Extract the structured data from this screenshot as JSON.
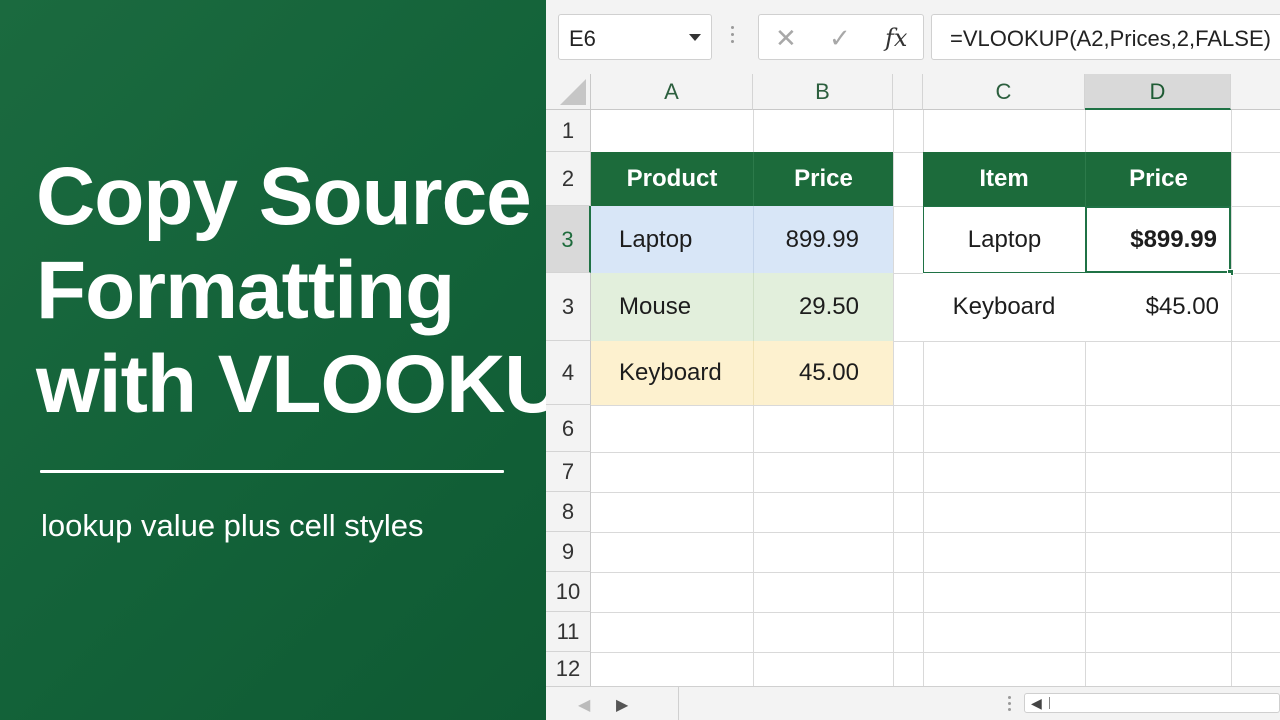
{
  "hero": {
    "title_lines": [
      "Copy Source",
      "Formatting",
      "with VLOOKUP"
    ],
    "subtitle": "lookup value plus cell styles"
  },
  "toolbar": {
    "name_box": "E6",
    "cancel_icon": "✕",
    "enter_icon": "✓",
    "fx_label": "fx",
    "formula": "=VLOOKUP(A2,Prices,2,FALSE)"
  },
  "columns": [
    "A",
    "B",
    "C",
    "D"
  ],
  "rows": [
    "1",
    "2",
    "3",
    "3",
    "4",
    "6",
    "7",
    "8",
    "9",
    "10",
    "11",
    "12"
  ],
  "source_table": {
    "headers": [
      "Product",
      "Price"
    ],
    "rows": [
      {
        "product": "Laptop",
        "price": "899.99",
        "style": "blue"
      },
      {
        "product": "Mouse",
        "price": "29.50",
        "style": "green"
      },
      {
        "product": "Keyboard",
        "price": "45.00",
        "style": "yellow"
      }
    ]
  },
  "lookup_table": {
    "headers": [
      "Item",
      "Price"
    ],
    "rows": [
      {
        "item": "Laptop",
        "price": "$899.99"
      },
      {
        "item": "Keyboard",
        "price": "$45.00"
      }
    ]
  },
  "colors": {
    "brand_green": "#1c6b3b",
    "blue_fill": "#d8e6f7",
    "green_fill": "#e2efdc",
    "yellow_fill": "#fdf1cf"
  },
  "statusbar": {
    "prev_icon": "◀",
    "next_icon": "▶",
    "scroll_left_icon": "◀"
  }
}
